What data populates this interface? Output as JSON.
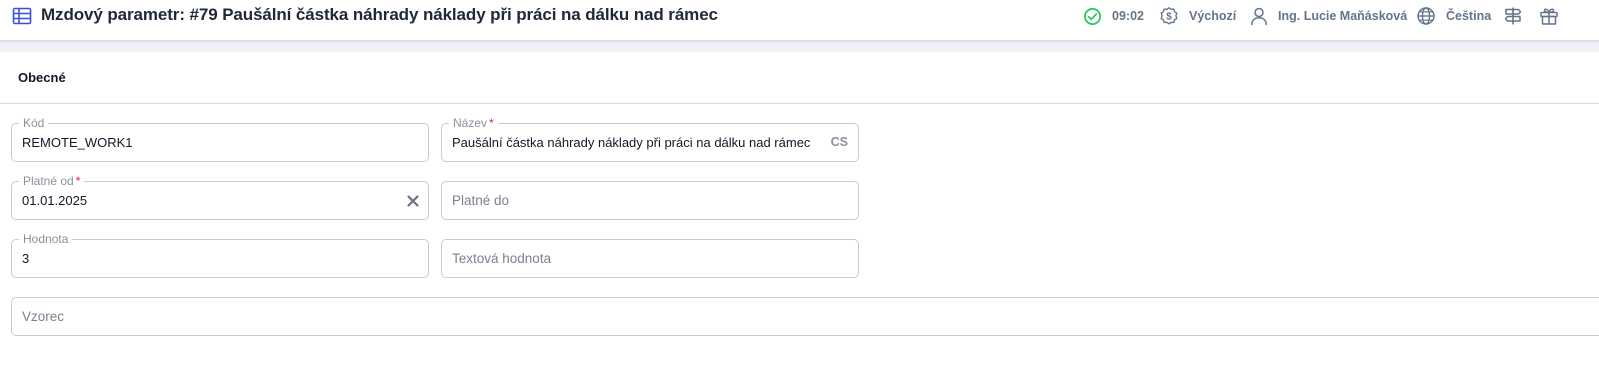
{
  "header": {
    "title": "Mzdový parametr: #79 Paušální částka náhrady náklady při práci na dálku nad rámec",
    "time": "09:02",
    "currency": "Výchozí",
    "user": "Ing. Lucie Maňásková",
    "language": "Čeština",
    "icons": {
      "title": "table-icon",
      "time": "check-circle-icon",
      "currency": "dollar-badge-icon",
      "user": "user-icon",
      "language": "globe-icon",
      "extra1": "signpost-icon",
      "extra2": "gift-icon"
    },
    "colors": {
      "status_ok": "#22c55e",
      "title_icon": "#3b4fd8"
    }
  },
  "section": {
    "title": "Obecné"
  },
  "form": {
    "kod": {
      "label": "Kód",
      "value": "REMOTE_WORK1"
    },
    "nazev": {
      "label": "Název",
      "required_mark": "*",
      "value": "Paušální částka náhrady náklady při práci na dálku nad rámec",
      "lang": "CS"
    },
    "platne_od": {
      "label": "Platné od",
      "required_mark": "*",
      "value": "01.01.2025"
    },
    "platne_do": {
      "placeholder": "Platné do"
    },
    "hodnota": {
      "label": "Hodnota",
      "value": "3"
    },
    "textova_hodnota": {
      "placeholder": "Textová hodnota"
    },
    "vzorec": {
      "placeholder": "Vzorec"
    }
  }
}
